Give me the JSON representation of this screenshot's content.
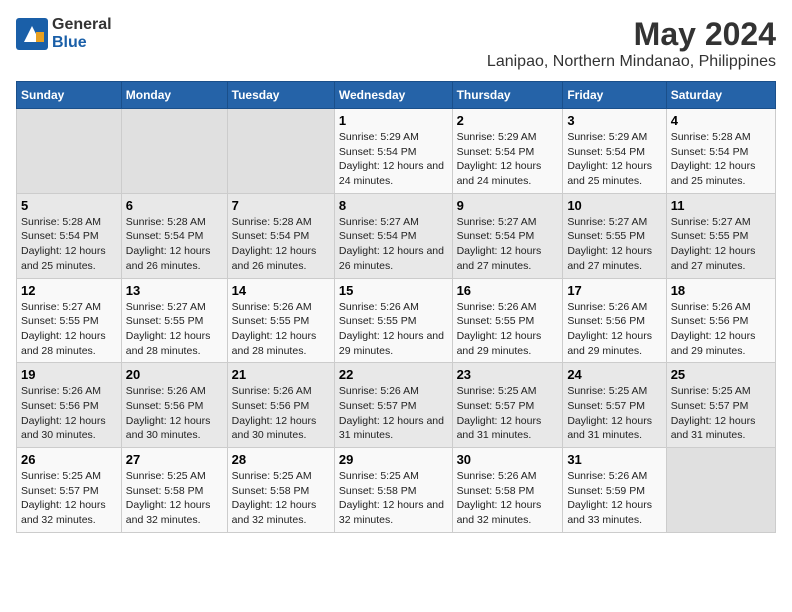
{
  "header": {
    "logo_general": "General",
    "logo_blue": "Blue",
    "title": "May 2024",
    "subtitle": "Lanipao, Northern Mindanao, Philippines"
  },
  "weekdays": [
    "Sunday",
    "Monday",
    "Tuesday",
    "Wednesday",
    "Thursday",
    "Friday",
    "Saturday"
  ],
  "weeks": [
    {
      "days": [
        {
          "num": "",
          "empty": true
        },
        {
          "num": "",
          "empty": true
        },
        {
          "num": "",
          "empty": true
        },
        {
          "num": "1",
          "sunrise": "5:29 AM",
          "sunset": "5:54 PM",
          "daylight": "12 hours and 24 minutes."
        },
        {
          "num": "2",
          "sunrise": "5:29 AM",
          "sunset": "5:54 PM",
          "daylight": "12 hours and 24 minutes."
        },
        {
          "num": "3",
          "sunrise": "5:29 AM",
          "sunset": "5:54 PM",
          "daylight": "12 hours and 25 minutes."
        },
        {
          "num": "4",
          "sunrise": "5:28 AM",
          "sunset": "5:54 PM",
          "daylight": "12 hours and 25 minutes."
        }
      ]
    },
    {
      "days": [
        {
          "num": "5",
          "sunrise": "5:28 AM",
          "sunset": "5:54 PM",
          "daylight": "12 hours and 25 minutes."
        },
        {
          "num": "6",
          "sunrise": "5:28 AM",
          "sunset": "5:54 PM",
          "daylight": "12 hours and 26 minutes."
        },
        {
          "num": "7",
          "sunrise": "5:28 AM",
          "sunset": "5:54 PM",
          "daylight": "12 hours and 26 minutes."
        },
        {
          "num": "8",
          "sunrise": "5:27 AM",
          "sunset": "5:54 PM",
          "daylight": "12 hours and 26 minutes."
        },
        {
          "num": "9",
          "sunrise": "5:27 AM",
          "sunset": "5:54 PM",
          "daylight": "12 hours and 27 minutes."
        },
        {
          "num": "10",
          "sunrise": "5:27 AM",
          "sunset": "5:55 PM",
          "daylight": "12 hours and 27 minutes."
        },
        {
          "num": "11",
          "sunrise": "5:27 AM",
          "sunset": "5:55 PM",
          "daylight": "12 hours and 27 minutes."
        }
      ]
    },
    {
      "days": [
        {
          "num": "12",
          "sunrise": "5:27 AM",
          "sunset": "5:55 PM",
          "daylight": "12 hours and 28 minutes."
        },
        {
          "num": "13",
          "sunrise": "5:27 AM",
          "sunset": "5:55 PM",
          "daylight": "12 hours and 28 minutes."
        },
        {
          "num": "14",
          "sunrise": "5:26 AM",
          "sunset": "5:55 PM",
          "daylight": "12 hours and 28 minutes."
        },
        {
          "num": "15",
          "sunrise": "5:26 AM",
          "sunset": "5:55 PM",
          "daylight": "12 hours and 29 minutes."
        },
        {
          "num": "16",
          "sunrise": "5:26 AM",
          "sunset": "5:55 PM",
          "daylight": "12 hours and 29 minutes."
        },
        {
          "num": "17",
          "sunrise": "5:26 AM",
          "sunset": "5:56 PM",
          "daylight": "12 hours and 29 minutes."
        },
        {
          "num": "18",
          "sunrise": "5:26 AM",
          "sunset": "5:56 PM",
          "daylight": "12 hours and 29 minutes."
        }
      ]
    },
    {
      "days": [
        {
          "num": "19",
          "sunrise": "5:26 AM",
          "sunset": "5:56 PM",
          "daylight": "12 hours and 30 minutes."
        },
        {
          "num": "20",
          "sunrise": "5:26 AM",
          "sunset": "5:56 PM",
          "daylight": "12 hours and 30 minutes."
        },
        {
          "num": "21",
          "sunrise": "5:26 AM",
          "sunset": "5:56 PM",
          "daylight": "12 hours and 30 minutes."
        },
        {
          "num": "22",
          "sunrise": "5:26 AM",
          "sunset": "5:57 PM",
          "daylight": "12 hours and 31 minutes."
        },
        {
          "num": "23",
          "sunrise": "5:25 AM",
          "sunset": "5:57 PM",
          "daylight": "12 hours and 31 minutes."
        },
        {
          "num": "24",
          "sunrise": "5:25 AM",
          "sunset": "5:57 PM",
          "daylight": "12 hours and 31 minutes."
        },
        {
          "num": "25",
          "sunrise": "5:25 AM",
          "sunset": "5:57 PM",
          "daylight": "12 hours and 31 minutes."
        }
      ]
    },
    {
      "days": [
        {
          "num": "26",
          "sunrise": "5:25 AM",
          "sunset": "5:57 PM",
          "daylight": "12 hours and 32 minutes."
        },
        {
          "num": "27",
          "sunrise": "5:25 AM",
          "sunset": "5:58 PM",
          "daylight": "12 hours and 32 minutes."
        },
        {
          "num": "28",
          "sunrise": "5:25 AM",
          "sunset": "5:58 PM",
          "daylight": "12 hours and 32 minutes."
        },
        {
          "num": "29",
          "sunrise": "5:25 AM",
          "sunset": "5:58 PM",
          "daylight": "12 hours and 32 minutes."
        },
        {
          "num": "30",
          "sunrise": "5:26 AM",
          "sunset": "5:58 PM",
          "daylight": "12 hours and 32 minutes."
        },
        {
          "num": "31",
          "sunrise": "5:26 AM",
          "sunset": "5:59 PM",
          "daylight": "12 hours and 33 minutes."
        },
        {
          "num": "",
          "empty": true
        }
      ]
    }
  ]
}
